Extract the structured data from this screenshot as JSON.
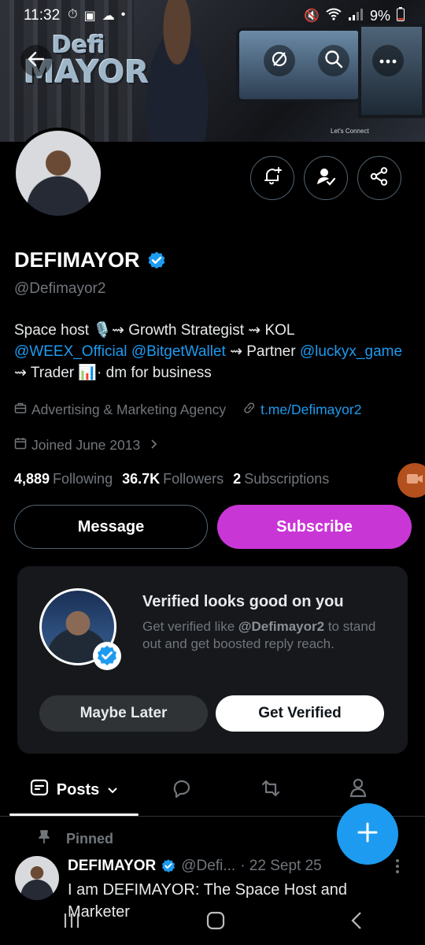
{
  "status_bar": {
    "time": "11:32",
    "battery": "9%"
  },
  "banner": {
    "logo_line1": "Defi",
    "logo_line2": "MAYOR",
    "caption": "Let's Connect"
  },
  "profile": {
    "name": "DEFIMAYOR",
    "handle": "@Defimayor2",
    "bio": {
      "line1": "Space host 🎙️⇝ Growth Strategist ⇝ KOL",
      "link1": "@WEEX_Official",
      "link2": "@BitgetWallet",
      "mid": "⇝ Partner",
      "link3": "@luckyx_game",
      "line3": "⇝ Trader 📊· dm for business"
    },
    "category": "Advertising & Marketing Agency",
    "website": "t.me/Defimayor2",
    "joined": "Joined June 2013",
    "following_count": "4,889",
    "following_label": "Following",
    "followers_count": "36.7K",
    "followers_label": "Followers",
    "subscriptions_count": "2",
    "subscriptions_label": "Subscriptions"
  },
  "actions": {
    "message": "Message",
    "subscribe": "Subscribe"
  },
  "verify_card": {
    "title": "Verified looks good on you",
    "text_pre": "Get verified like",
    "text_handle": "@Defimayor2",
    "text_post": "to stand out and get boosted reply reach.",
    "maybe_later": "Maybe Later",
    "get_verified": "Get Verified"
  },
  "tabs": {
    "posts": "Posts"
  },
  "post": {
    "pinned_label": "Pinned",
    "author": "DEFIMAYOR",
    "handle": "@Defi...",
    "date": "· 22 Sept 25",
    "text": "I am DEFIMAYOR: The Space Host and Marketer"
  },
  "colors": {
    "accent": "#1d9bf0",
    "subscribe": "#c936d6",
    "background": "#000000"
  },
  "icons": [
    "back-arrow-icon",
    "no-eye-icon",
    "search-icon",
    "more-icon",
    "bell-plus-icon",
    "user-check-icon",
    "share-icon",
    "briefcase-icon",
    "link-icon",
    "calendar-icon",
    "chevron-right-icon",
    "posts-icon",
    "reply-icon",
    "repost-icon",
    "person-icon",
    "pin-icon",
    "plus-icon"
  ]
}
